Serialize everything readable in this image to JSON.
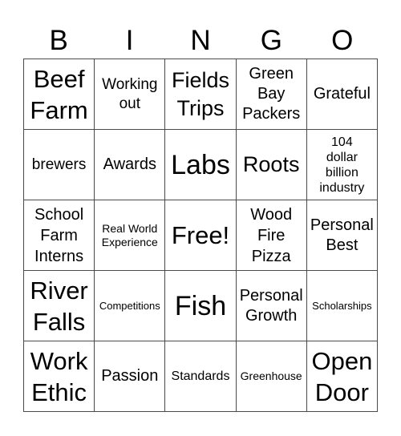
{
  "header": {
    "letters": [
      "B",
      "I",
      "N",
      "G",
      "O"
    ]
  },
  "board": {
    "rows": [
      [
        "Beef Farm",
        "Working out",
        "Fields Trips",
        "Green Bay Packers",
        "Grateful"
      ],
      [
        "brewers",
        "Awards",
        "Labs",
        "Roots",
        "104 dollar billion industry"
      ],
      [
        "School Farm Interns",
        "Real World Experience",
        "Free!",
        "Wood Fire Pizza",
        "Personal Best"
      ],
      [
        "River Falls",
        "Competitions",
        "Fish",
        "Personal Growth",
        "Scholarships"
      ],
      [
        "Work Ethic",
        "Passion",
        "Standards",
        "Greenhouse",
        "Open Door"
      ]
    ]
  }
}
